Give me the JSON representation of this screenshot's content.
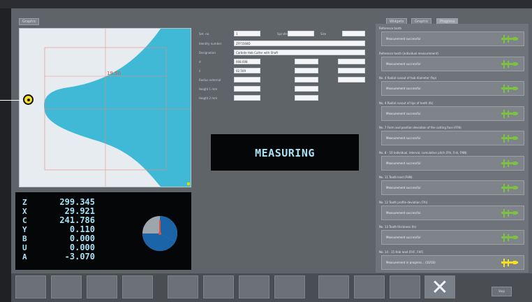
{
  "tabs_left": [
    "Graphic"
  ],
  "tabs_right": [
    "Widgets",
    "Graphic",
    "Progress"
  ],
  "drawing": {
    "dimension_label": "19.50"
  },
  "form": {
    "rows": [
      {
        "label": "Set. no.",
        "value": "1"
      },
      {
        "label": "Identity number",
        "value": "ZFF5568D"
      },
      {
        "label": "Designation",
        "value": "Carbide Hob Cutter with Shaft"
      },
      {
        "label": "d",
        "value": "008.008"
      },
      {
        "label": "z",
        "value": "02.509"
      },
      {
        "label": "Radius external",
        "value": ""
      },
      {
        "label": "Height 1 mm",
        "value": ""
      },
      {
        "label": "Height 2 mm",
        "value": ""
      }
    ],
    "extra_labels": [
      "Spindle",
      "Size"
    ]
  },
  "dro": [
    {
      "axis": "Z",
      "value": "299.345"
    },
    {
      "axis": "X",
      "value": "29.921"
    },
    {
      "axis": "C",
      "value": "241.786"
    },
    {
      "axis": "Y",
      "value": "0.110"
    },
    {
      "axis": "B",
      "value": "0.000"
    },
    {
      "axis": "U",
      "value": "0.000"
    },
    {
      "axis": "A",
      "value": "-3.070"
    }
  ],
  "status_display": "MEASURING",
  "results": [
    {
      "title": "Reference tooth",
      "status": "Measurement successful",
      "state": "ok"
    },
    {
      "title": "Reference tooth (individual measurement)",
      "status": "Measurement successful",
      "state": "ok"
    },
    {
      "title": "No. 4 Radial runout of hob diameter (fsp)",
      "status": "Measurement successful",
      "state": "ok"
    },
    {
      "title": "No. 4 Radial runout of tips of teeth (fk)",
      "status": "Measurement successful",
      "state": "ok"
    },
    {
      "title": "No. 7 Form and position deviation of the cutting face (FFN)",
      "status": "Measurement successful",
      "state": "ok"
    },
    {
      "title": "No. 8 - 10 Individual, interval, cumulative pitch (Fth, Fnh, FNN)",
      "status": "Measurement successful",
      "state": "ok"
    },
    {
      "title": "No. 11 Tooth lead (FHN)",
      "status": "Measurement successful",
      "state": "ok"
    },
    {
      "title": "No. 12 Tooth profile deviation (Ffn)",
      "status": "Measurement successful",
      "state": "ok"
    },
    {
      "title": "No. 13 Tooth thickness (fs)",
      "status": "Measurement successful",
      "state": "ok"
    },
    {
      "title": "No. 14 - 15 Hob lead (FHF, FHF)",
      "status": "Measurement in progress... (10/10)",
      "state": "progress"
    }
  ],
  "bottom": {
    "close_symbol": "✕",
    "small_button_label": "Stop"
  },
  "colors": {
    "ok": "#7cc241",
    "progress": "#f5df1e",
    "blue": "#3fb9d6",
    "dro_text": "#a9e2f5"
  }
}
